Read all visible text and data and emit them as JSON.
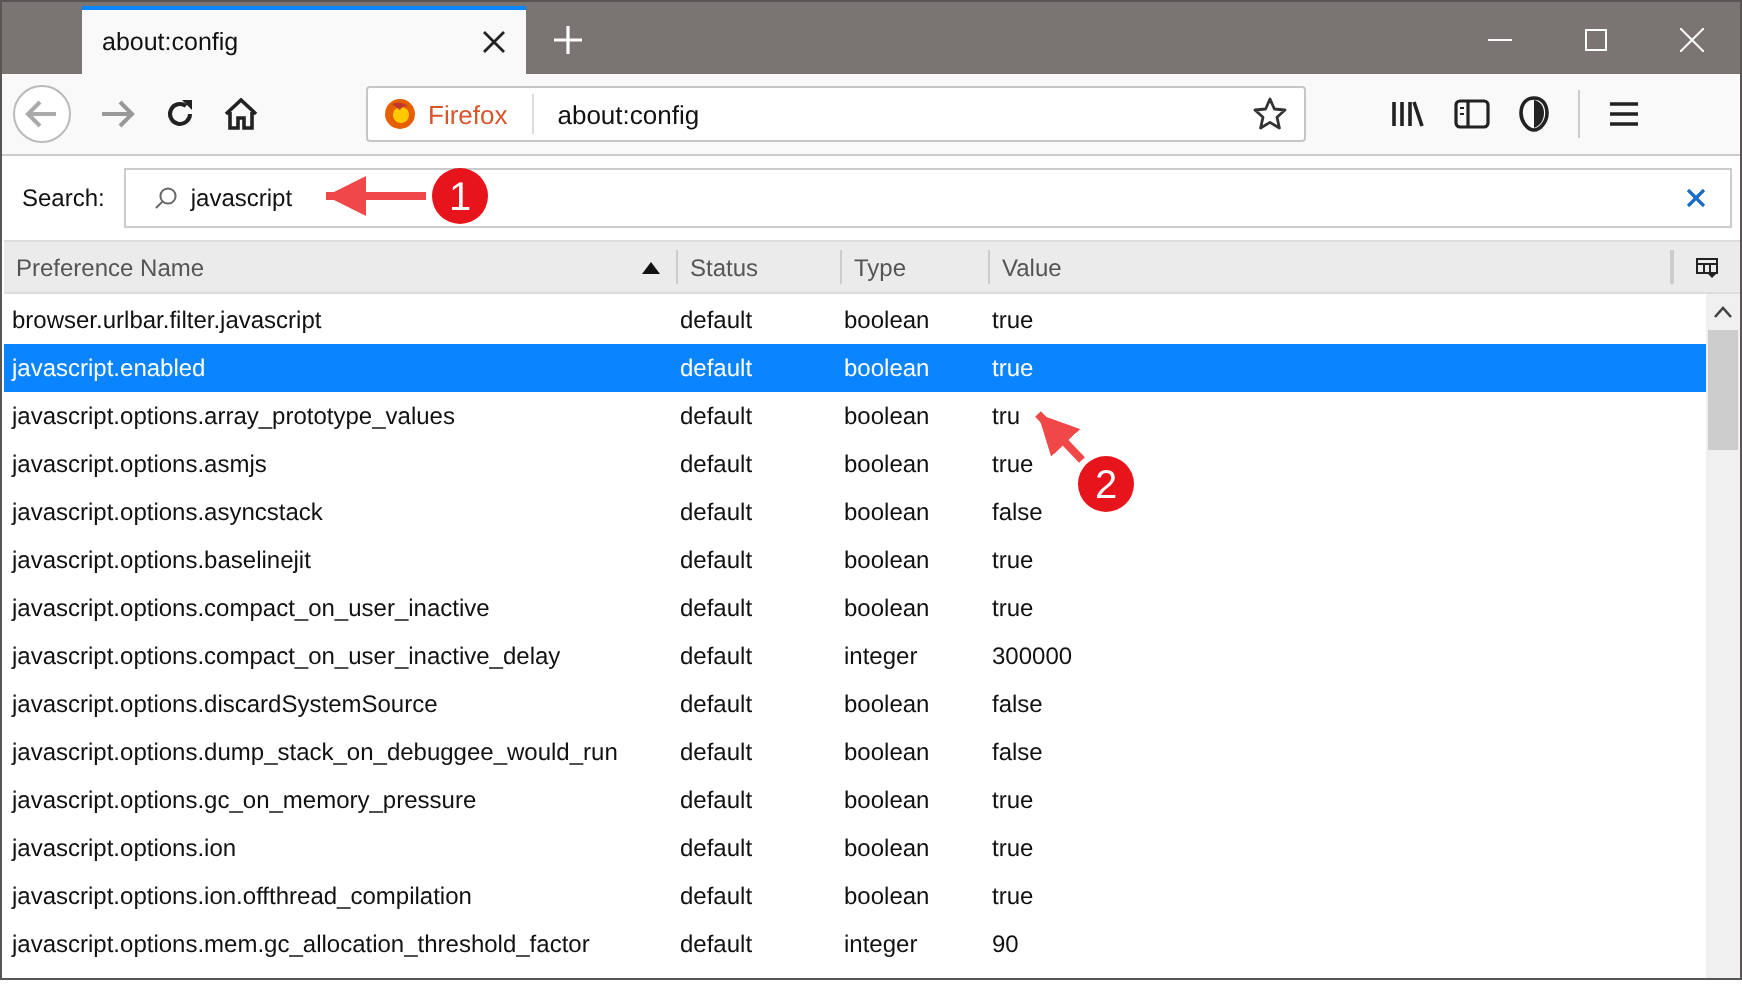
{
  "tab": {
    "title": "about:config",
    "selected": true
  },
  "url_bar": {
    "identity": "Firefox",
    "url": "about:config"
  },
  "search": {
    "label": "Search:",
    "value": "javascript"
  },
  "columns": [
    {
      "label": "Preference Name",
      "sorted": true
    },
    {
      "label": "Status",
      "sorted": false
    },
    {
      "label": "Type",
      "sorted": false
    },
    {
      "label": "Value",
      "sorted": false
    }
  ],
  "rows": [
    {
      "name": "browser.urlbar.filter.javascript",
      "status": "default",
      "type": "boolean",
      "value": "true",
      "selected": false
    },
    {
      "name": "javascript.enabled",
      "status": "default",
      "type": "boolean",
      "value": "true",
      "selected": true
    },
    {
      "name": "javascript.options.array_prototype_values",
      "status": "default",
      "type": "boolean",
      "value": "tru",
      "selected": false
    },
    {
      "name": "javascript.options.asmjs",
      "status": "default",
      "type": "boolean",
      "value": "true",
      "selected": false
    },
    {
      "name": "javascript.options.asyncstack",
      "status": "default",
      "type": "boolean",
      "value": "false",
      "selected": false
    },
    {
      "name": "javascript.options.baselinejit",
      "status": "default",
      "type": "boolean",
      "value": "true",
      "selected": false
    },
    {
      "name": "javascript.options.compact_on_user_inactive",
      "status": "default",
      "type": "boolean",
      "value": "true",
      "selected": false
    },
    {
      "name": "javascript.options.compact_on_user_inactive_delay",
      "status": "default",
      "type": "integer",
      "value": "300000",
      "selected": false
    },
    {
      "name": "javascript.options.discardSystemSource",
      "status": "default",
      "type": "boolean",
      "value": "false",
      "selected": false
    },
    {
      "name": "javascript.options.dump_stack_on_debuggee_would_run",
      "status": "default",
      "type": "boolean",
      "value": "false",
      "selected": false
    },
    {
      "name": "javascript.options.gc_on_memory_pressure",
      "status": "default",
      "type": "boolean",
      "value": "true",
      "selected": false
    },
    {
      "name": "javascript.options.ion",
      "status": "default",
      "type": "boolean",
      "value": "true",
      "selected": false
    },
    {
      "name": "javascript.options.ion.offthread_compilation",
      "status": "default",
      "type": "boolean",
      "value": "true",
      "selected": false
    },
    {
      "name": "javascript.options.mem.gc_allocation_threshold_factor",
      "status": "default",
      "type": "integer",
      "value": "90",
      "selected": false
    }
  ],
  "annotations": [
    {
      "label": "1"
    },
    {
      "label": "2"
    }
  ]
}
